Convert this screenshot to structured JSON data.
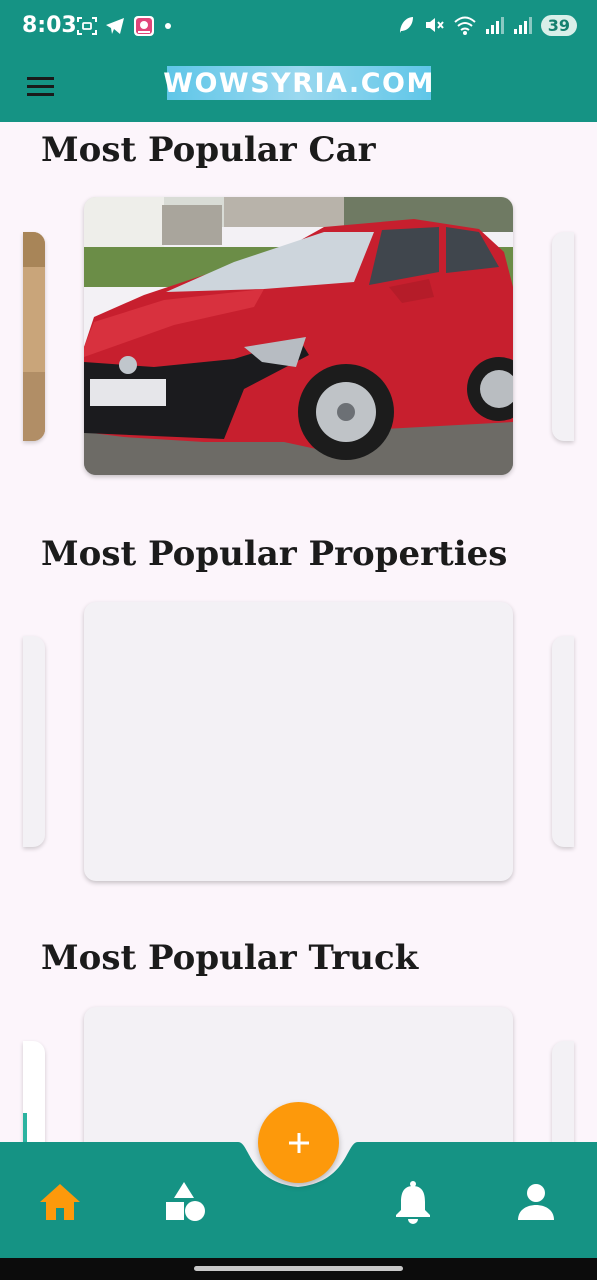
{
  "status_bar": {
    "time": "8:03",
    "battery": "39",
    "left_icons": [
      "screenshot-icon",
      "telegram-icon",
      "app-notification-icon",
      "dot-icon"
    ],
    "right_icons": [
      "leaf-icon",
      "mute-icon",
      "wifi-icon",
      "signal-icon",
      "signal-icon"
    ]
  },
  "app_bar": {
    "menu_icon": "menu-icon",
    "brand": "WOWSYRIA.COM",
    "background": "#159384"
  },
  "sections": [
    {
      "title": "Most Popular Car"
    },
    {
      "title": "Most Popular Properties"
    },
    {
      "title": "Most Popular Truck"
    }
  ],
  "fab": {
    "icon": "plus-icon",
    "color": "#fd990b"
  },
  "bottom_nav": {
    "items": [
      {
        "icon": "home-icon",
        "active": true
      },
      {
        "icon": "categories-icon",
        "active": false
      },
      {
        "icon": "bell-icon",
        "active": false
      },
      {
        "icon": "person-icon",
        "active": false
      }
    ],
    "active_color": "#fd990b"
  }
}
